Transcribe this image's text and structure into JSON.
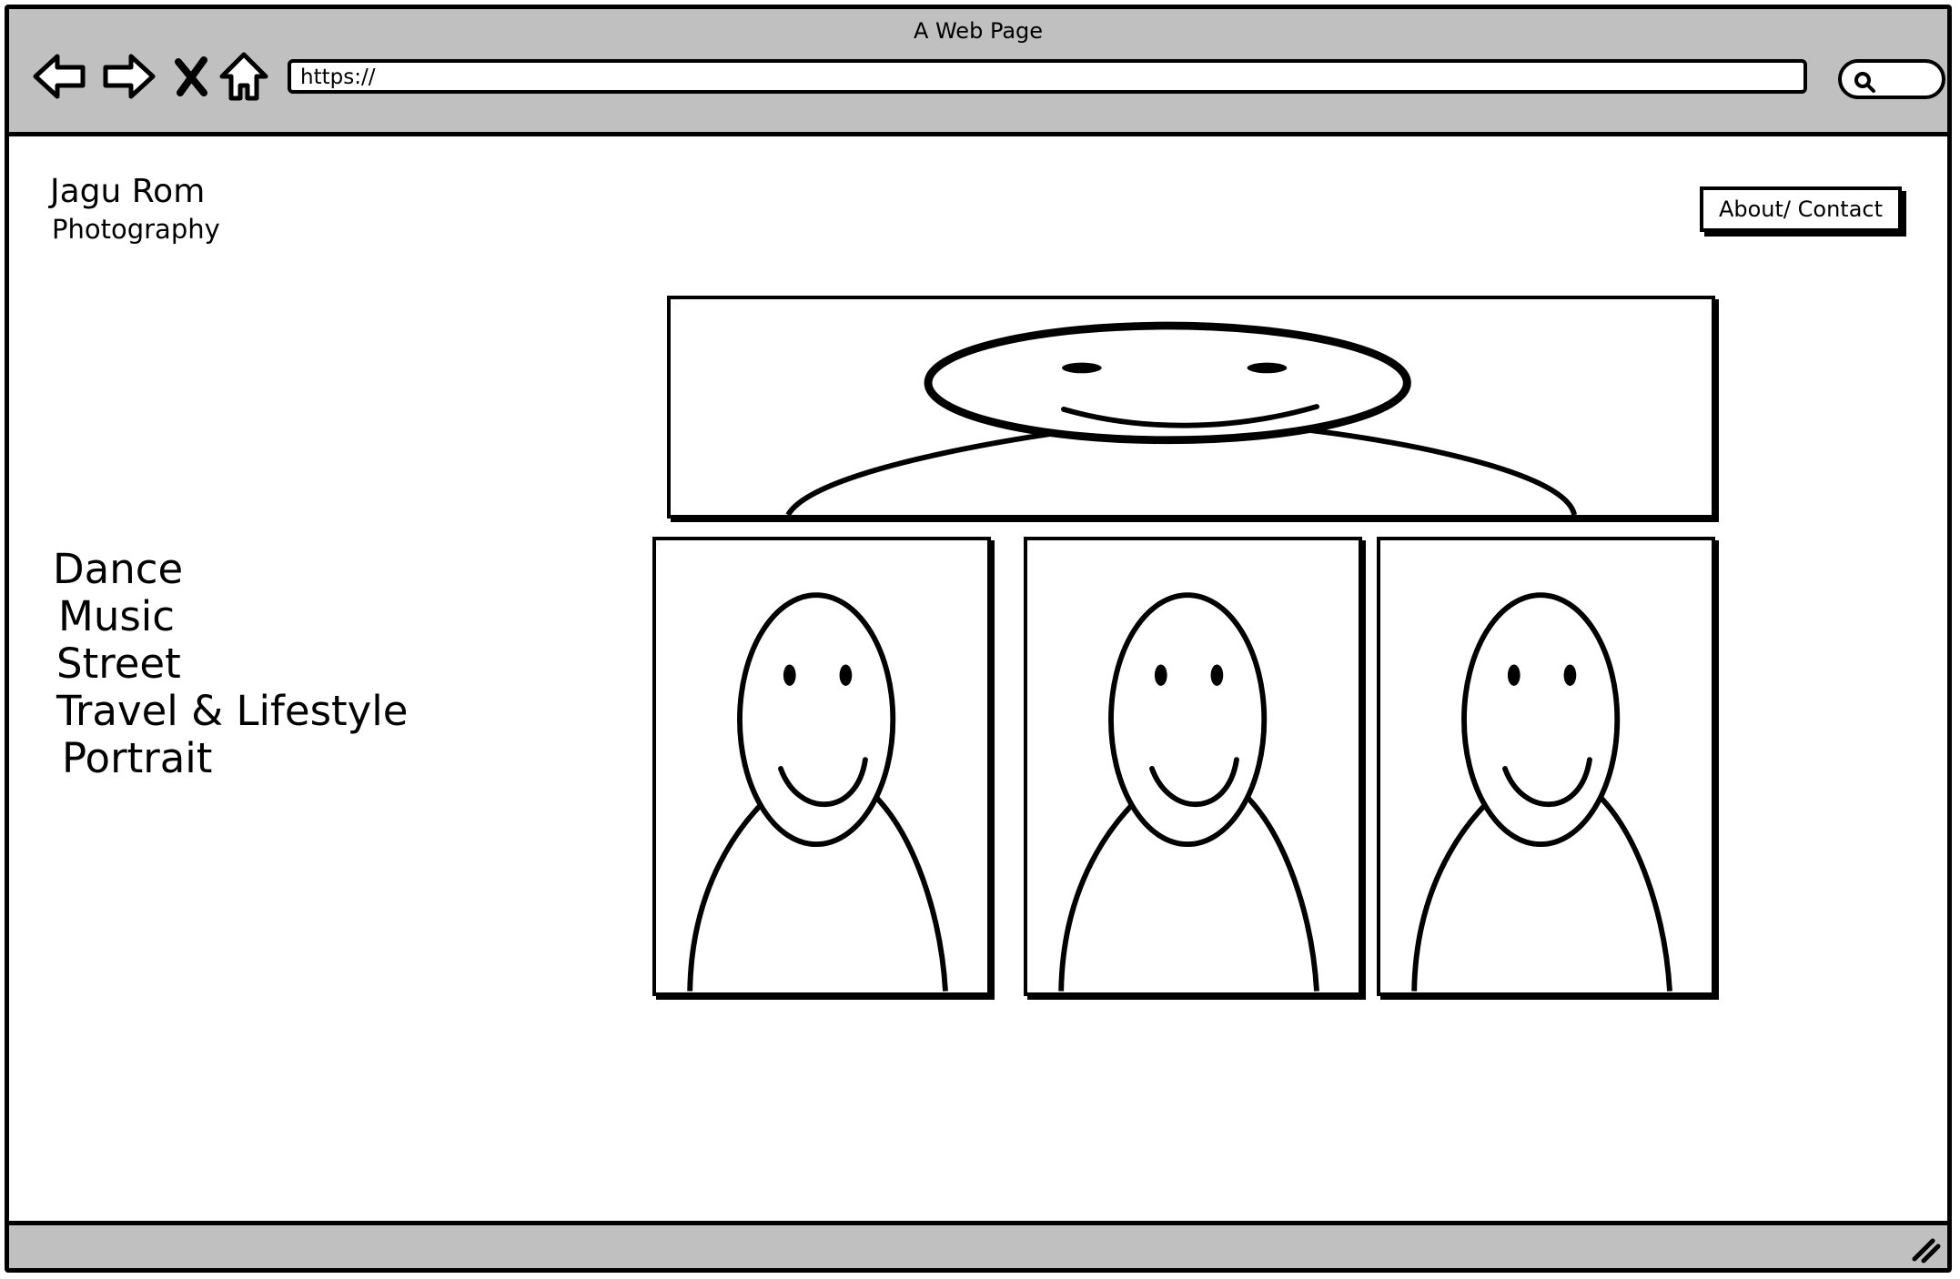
{
  "window": {
    "title": "A Web Page"
  },
  "browser": {
    "url": "https://",
    "icons": [
      "back-arrow-icon",
      "forward-arrow-icon",
      "close-icon",
      "home-icon",
      "search-icon",
      "resize-grip-icon"
    ]
  },
  "site": {
    "brand_name": "Jagu Rom",
    "brand_subtitle": "Photography",
    "about_label": "About/ Contact"
  },
  "categories": [
    {
      "label": "Dance"
    },
    {
      "label": "Music"
    },
    {
      "label": "Street"
    },
    {
      "label": "Travel & Lifestyle"
    },
    {
      "label": "Portrait"
    }
  ],
  "gallery": {
    "hero_placeholder": "image-placeholder-wide",
    "thumbnails": [
      "image-placeholder",
      "image-placeholder",
      "image-placeholder"
    ]
  },
  "colors": {
    "chrome": "#c0c0c0",
    "ink": "#000000",
    "canvas": "#ffffff"
  }
}
